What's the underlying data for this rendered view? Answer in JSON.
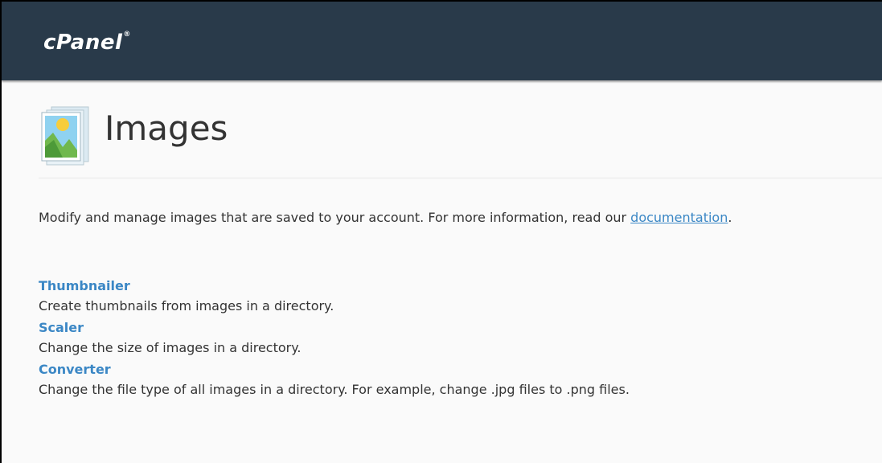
{
  "header": {
    "logo_text": "cPanel",
    "logo_mark": "®"
  },
  "page": {
    "title": "Images",
    "icon": "images-icon"
  },
  "intro": {
    "text": "Modify and manage images that are saved to your account. For more information, read our ",
    "link_text": "documentation",
    "trailing": "."
  },
  "features": [
    {
      "label": "Thumbnailer",
      "description": "Create thumbnails from images in a directory."
    },
    {
      "label": "Scaler",
      "description": "Change the size of images in a directory."
    },
    {
      "label": "Converter",
      "description": "Change the file type of all images in a directory. For example, change .jpg files to .png files."
    }
  ],
  "colors": {
    "topbar": "#293a4a",
    "link": "#3b87c5",
    "text": "#333333",
    "background": "#fafafa"
  }
}
